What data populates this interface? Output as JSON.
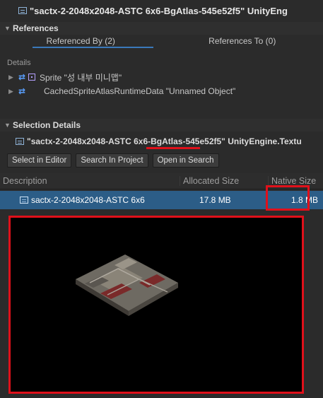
{
  "title": "\"sactx-2-2048x2048-ASTC 6x6-BgAtlas-545e52f5\" UnityEng",
  "references": {
    "header": "References",
    "tab_referenced_by": "Referenced By (2)",
    "tab_references_to": "References To (0)",
    "details_label": "Details",
    "items": [
      {
        "label": "Sprite \"성 내부 미니맵\""
      },
      {
        "label": "CachedSpriteAtlasRuntimeData \"Unnamed Object\""
      }
    ]
  },
  "selection": {
    "header": "Selection Details",
    "object_name": "\"sactx-2-2048x2048-ASTC 6x6-BgAtlas-545e52f5\" UnityEngine.Textu",
    "buttons": {
      "select_in_editor": "Select in Editor",
      "search_in_project": "Search In Project",
      "open_in_search": "Open in Search"
    },
    "table": {
      "headers": [
        "Description",
        "Allocated Size",
        "Native Size"
      ],
      "row": {
        "description": "sactx-2-2048x2048-ASTC 6x6",
        "allocated": "17.8 MB",
        "native": "1.8 MB"
      }
    }
  },
  "colors": {
    "highlight": "#e0101a",
    "selection": "#2c5d87",
    "background": "#2b2b2b"
  }
}
